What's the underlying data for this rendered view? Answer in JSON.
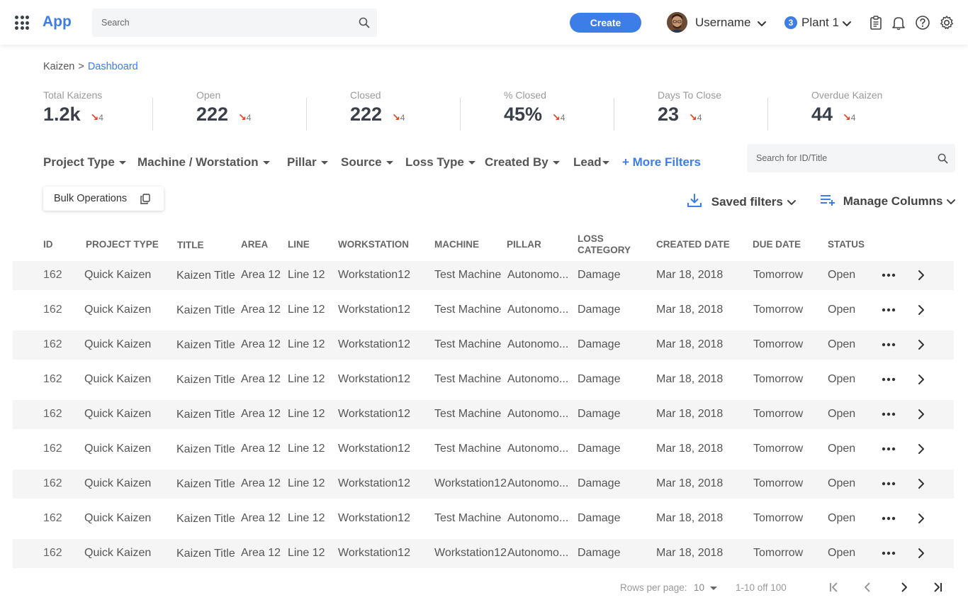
{
  "header": {
    "app_name": "App",
    "search_placeholder": "Search",
    "create_label": "Create",
    "username": "Username",
    "plant_count": "3",
    "plant_name": "Plant 1"
  },
  "breadcrumb": {
    "root": "Kaizen",
    "separator": ">",
    "current": "Dashboard"
  },
  "stats": [
    {
      "label": "Total Kaizens",
      "value": "1.2k",
      "trend": "4"
    },
    {
      "label": "Open",
      "value": "222",
      "trend": "4"
    },
    {
      "label": "Closed",
      "value": "222",
      "trend": "4"
    },
    {
      "label": "% Closed",
      "value": "45%",
      "trend": "4"
    },
    {
      "label": "Days To Close",
      "value": "23",
      "trend": "4"
    },
    {
      "label": "Overdue Kaizen",
      "value": "44",
      "trend": "4"
    }
  ],
  "trend_arrow": "↘",
  "filters": [
    "Project Type",
    "Machine / Worstation",
    "Pillar",
    "Source",
    "Loss Type",
    "Created By",
    "Lead"
  ],
  "more_filters": "+ More Filters",
  "id_search_placeholder": "Search for ID/Title",
  "toolbar": {
    "bulk_label": "Bulk Operations",
    "saved_filters_label": "Saved filters",
    "manage_columns_label": "Manage Columns"
  },
  "table": {
    "columns": [
      "ID",
      "PROJECT TYPE",
      "TITLE",
      "AREA",
      "LINE",
      "WORKSTATION",
      "MACHINE",
      "PILLAR",
      "LOSS CATEGORY",
      "CREATED DATE",
      "DUE DATE",
      "STATUS"
    ],
    "rows": [
      [
        "162",
        "Quick Kaizen",
        "Kaizen Title",
        "Area 12",
        "Line 12",
        "Workstation12",
        "Test Machine",
        "Autonomo...",
        "Damage",
        "Mar 18, 2018",
        "Tomorrow",
        "Open"
      ],
      [
        "162",
        "Quick Kaizen",
        "Kaizen Title",
        "Area 12",
        "Line 12",
        "Workstation12",
        "Test Machine",
        "Autonomo...",
        "Damage",
        "Mar 18, 2018",
        "Tomorrow",
        "Open"
      ],
      [
        "162",
        "Quick Kaizen",
        "Kaizen Title",
        "Area 12",
        "Line 12",
        "Workstation12",
        "Test Machine",
        "Autonomo...",
        "Damage",
        "Mar 18, 2018",
        "Tomorrow",
        "Open"
      ],
      [
        "162",
        "Quick Kaizen",
        "Kaizen Title",
        "Area 12",
        "Line 12",
        "Workstation12",
        "Test Machine",
        "Autonomo...",
        "Damage",
        "Mar 18, 2018",
        "Tomorrow",
        "Open"
      ],
      [
        "162",
        "Quick Kaizen",
        "Kaizen Title",
        "Area 12",
        "Line 12",
        "Workstation12",
        "Test Machine",
        "Autonomo...",
        "Damage",
        "Mar 18, 2018",
        "Tomorrow",
        "Open"
      ],
      [
        "162",
        "Quick Kaizen",
        "Kaizen Title",
        "Area 12",
        "Line 12",
        "Workstation12",
        "Test Machine",
        "Autonomo...",
        "Damage",
        "Mar 18, 2018",
        "Tomorrow",
        "Open"
      ],
      [
        "162",
        "Quick Kaizen",
        "Kaizen Title",
        "Area 12",
        "Line 12",
        "Workstation12",
        "Workstation12",
        "Autonomo...",
        "Damage",
        "Mar 18, 2018",
        "Tomorrow",
        "Open"
      ],
      [
        "162",
        "Quick Kaizen",
        "Kaizen Title",
        "Area 12",
        "Line 12",
        "Workstation12",
        "Test Machine",
        "Autonomo...",
        "Damage",
        "Mar 18, 2018",
        "Tomorrow",
        "Open"
      ],
      [
        "162",
        "Quick Kaizen",
        "Kaizen Title",
        "Area 12",
        "Line 12",
        "Workstation12",
        "Workstation12",
        "Autonomo...",
        "Damage",
        "Mar 18, 2018",
        "Tomorrow",
        "Open"
      ]
    ]
  },
  "pagination": {
    "rows_per_page_label": "Rows per page:",
    "rows_per_page_value": "10",
    "range": "1-10 off 100"
  },
  "colors": {
    "accent": "#3d7de8",
    "trend_down": "#e0421b",
    "row_shade": "#f5f5f5"
  }
}
